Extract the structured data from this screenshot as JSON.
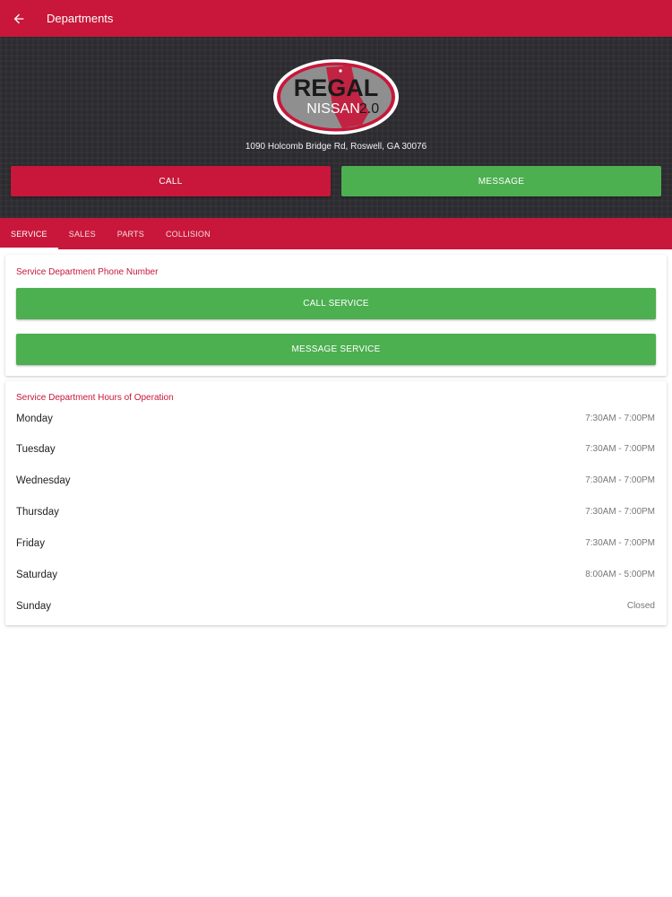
{
  "app_bar": {
    "title": "Departments",
    "back_icon": "arrow-left-icon"
  },
  "dealer": {
    "logo_text_top": "REGAL",
    "logo_text_bottom": "NISSAN",
    "logo_version": "2.0",
    "address": "1090 Holcomb Bridge Rd, Roswell, GA 30076",
    "call_label": "CALL",
    "message_label": "MESSAGE"
  },
  "tabs": [
    {
      "label": "SERVICE",
      "active": true
    },
    {
      "label": "SALES",
      "active": false
    },
    {
      "label": "PARTS",
      "active": false
    },
    {
      "label": "COLLISION",
      "active": false
    }
  ],
  "phone_card": {
    "title": "Service Department Phone Number",
    "call_label": "CALL SERVICE",
    "message_label": "MESSAGE SERVICE"
  },
  "hours_card": {
    "title": "Service Department Hours of Operation",
    "rows": [
      {
        "day": "Monday",
        "hours": "7:30AM - 7:00PM"
      },
      {
        "day": "Tuesday",
        "hours": "7:30AM - 7:00PM"
      },
      {
        "day": "Wednesday",
        "hours": "7:30AM - 7:00PM"
      },
      {
        "day": "Thursday",
        "hours": "7:30AM - 7:00PM"
      },
      {
        "day": "Friday",
        "hours": "7:30AM - 7:00PM"
      },
      {
        "day": "Saturday",
        "hours": "8:00AM - 5:00PM"
      },
      {
        "day": "Sunday",
        "hours": "Closed"
      }
    ]
  },
  "colors": {
    "primary_red": "#c8173a",
    "action_green": "#4caf50",
    "hero_background": "#2b2b30"
  }
}
